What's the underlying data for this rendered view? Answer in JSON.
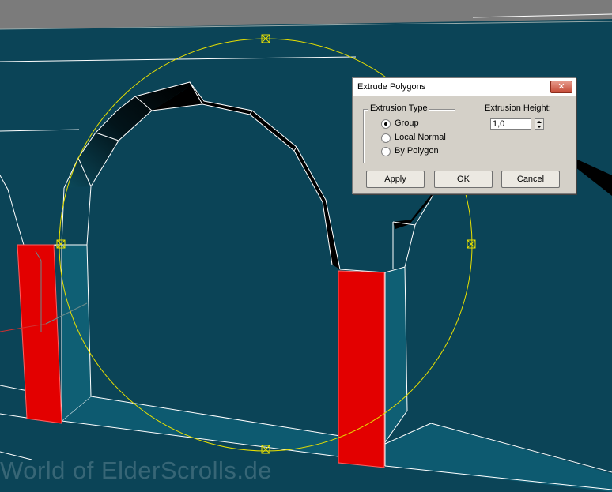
{
  "dialog": {
    "title": "Extrude Polygons",
    "close_icon": "close-icon",
    "extrusion_type": {
      "label": "Extrusion Type",
      "options": [
        "Group",
        "Local Normal",
        "By Polygon"
      ],
      "selected": "Group"
    },
    "extrusion_height": {
      "label": "Extrusion Height:",
      "value": "1,0"
    },
    "buttons": {
      "apply": "Apply",
      "ok": "OK",
      "cancel": "Cancel"
    }
  },
  "watermark": "World of ElderScrolls.de",
  "colors": {
    "viewport_background": "#0b4457",
    "selected_faces": "#e00000",
    "gizmo": "#e8e000",
    "edges": "#ffffff"
  }
}
